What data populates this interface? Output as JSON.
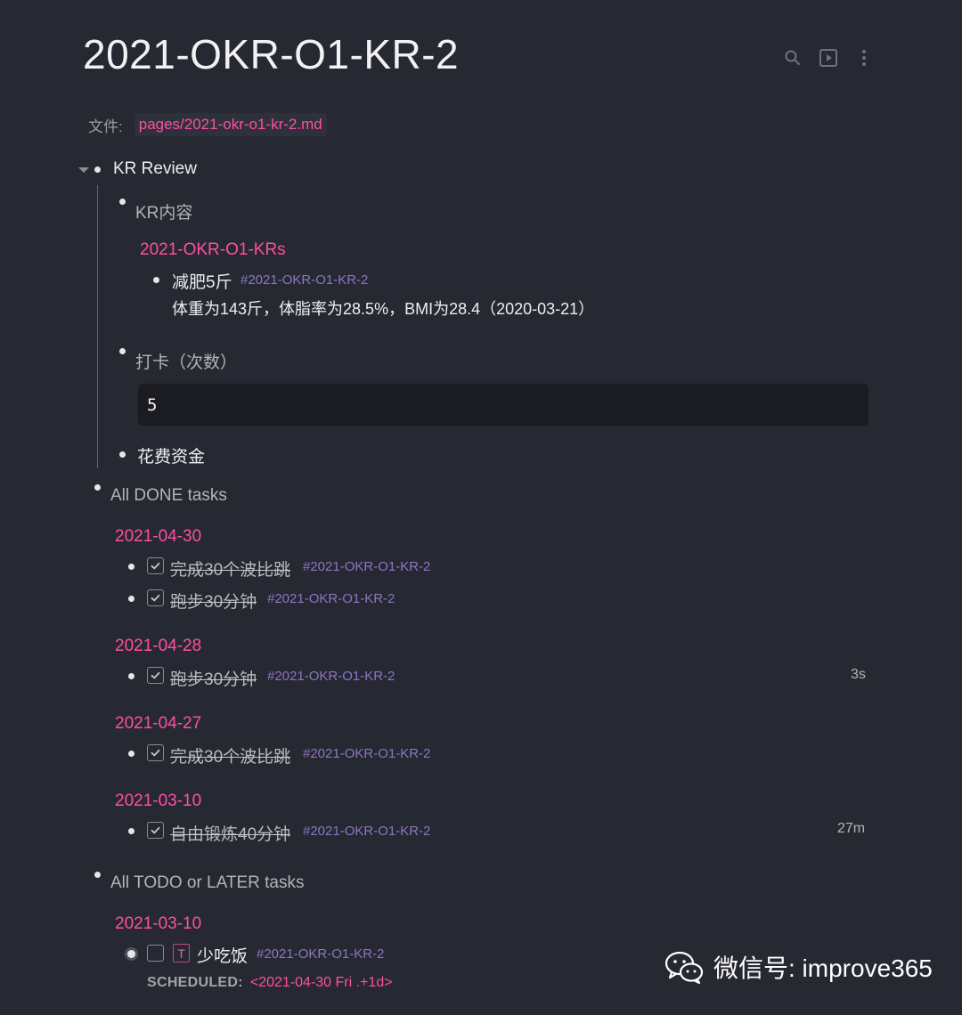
{
  "page": {
    "title": "2021-OKR-O1-KR-2"
  },
  "toolbar": {
    "icons": [
      "search-icon",
      "play-icon",
      "more-vertical-icon"
    ]
  },
  "file": {
    "label": "文件:",
    "path": "pages/2021-okr-o1-kr-2.md"
  },
  "outline": {
    "kr_review": "KR Review",
    "kr_content": {
      "label": "KR内容",
      "query_title": "2021-OKR-O1-KRs",
      "item_title": "减肥5斤",
      "item_tag": "#2021-OKR-O1-KR-2",
      "item_detail": "体重为143斤，体脂率为28.5%，BMI为28.4（2020-03-21）"
    },
    "checkins": {
      "label": "打卡（次数）",
      "value": "5"
    },
    "cost": {
      "label": "花费资金"
    }
  },
  "done": {
    "label": "All DONE tasks",
    "groups": [
      {
        "date": "2021-04-30",
        "tasks": [
          {
            "text": "完成30个波比跳",
            "tag": "#2021-OKR-O1-KR-2",
            "duration": ""
          },
          {
            "text": "跑步30分钟",
            "tag": "#2021-OKR-O1-KR-2",
            "duration": ""
          }
        ]
      },
      {
        "date": "2021-04-28",
        "tasks": [
          {
            "text": "跑步30分钟",
            "tag": "#2021-OKR-O1-KR-2",
            "duration": "3s"
          }
        ]
      },
      {
        "date": "2021-04-27",
        "tasks": [
          {
            "text": "完成30个波比跳",
            "tag": "#2021-OKR-O1-KR-2",
            "duration": ""
          }
        ]
      },
      {
        "date": "2021-03-10",
        "tasks": [
          {
            "text": "自由锻炼40分钟",
            "tag": "#2021-OKR-O1-KR-2",
            "duration": "27m"
          }
        ]
      }
    ]
  },
  "todo": {
    "label": "All TODO or LATER tasks",
    "date": "2021-03-10",
    "marker": "T",
    "text": "少吃饭",
    "tag": "#2021-OKR-O1-KR-2",
    "scheduled_label": "SCHEDULED:",
    "scheduled_value": "<2021-04-30 Fri .+1d>"
  },
  "watermark": {
    "text": "微信号: improve365"
  },
  "colors": {
    "background": "#262832",
    "accent": "#ff4fa3",
    "tag": "#8d76c4",
    "guide": "#4c6a8b"
  }
}
